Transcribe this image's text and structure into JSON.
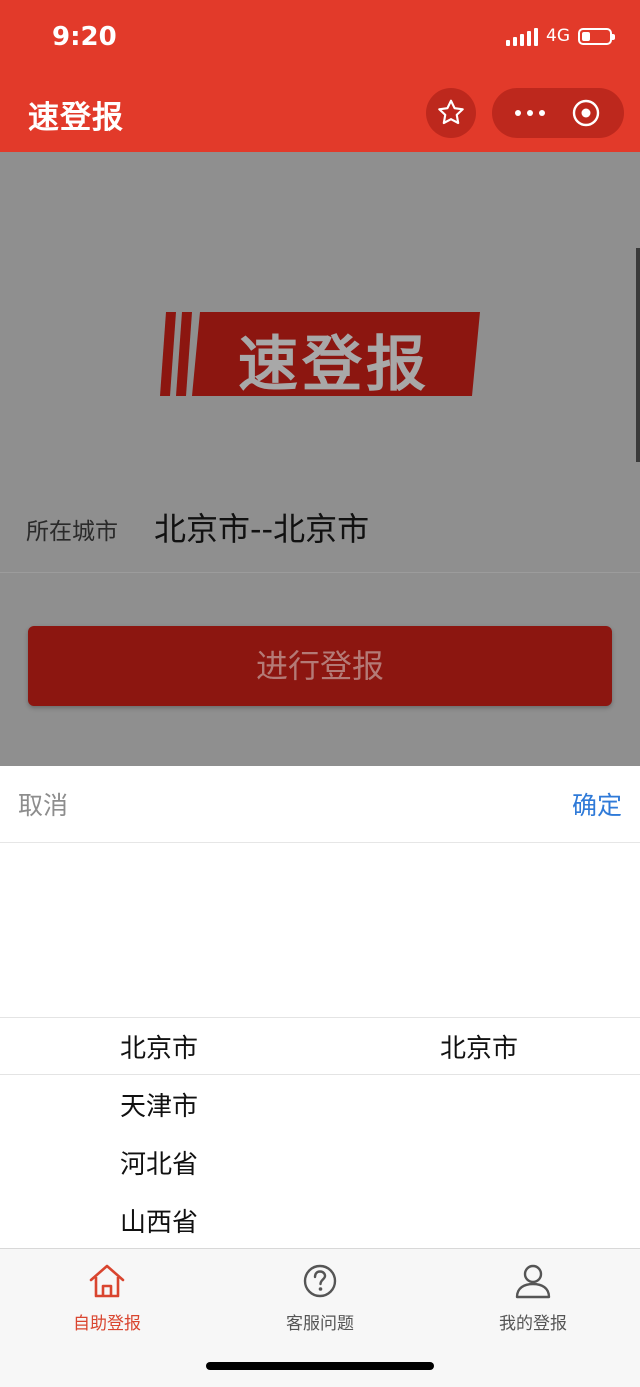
{
  "status": {
    "time": "9:20",
    "network": "4G"
  },
  "navbar": {
    "title": "速登报"
  },
  "logo": {
    "text": "速登报"
  },
  "form": {
    "city_label": "所在城市",
    "city_value": "北京市--北京市",
    "submit_label": "进行登报"
  },
  "picker": {
    "cancel_label": "取消",
    "confirm_label": "确定",
    "provinces": [
      "北京市",
      "天津市",
      "河北省",
      "山西省"
    ],
    "cities": [
      "北京市"
    ],
    "selected_province": "北京市",
    "selected_city": "北京市"
  },
  "tabbar": {
    "items": [
      {
        "label": "自助登报",
        "icon": "home-icon",
        "active": true
      },
      {
        "label": "客服问题",
        "icon": "help-icon",
        "active": false
      },
      {
        "label": "我的登报",
        "icon": "user-icon",
        "active": false
      }
    ]
  },
  "colors": {
    "brand_red": "#e23a2a",
    "button_dark_red": "#8c1610",
    "confirm_blue": "#2f7ad8",
    "tab_active": "#d9452f",
    "tab_inactive": "#555555"
  }
}
